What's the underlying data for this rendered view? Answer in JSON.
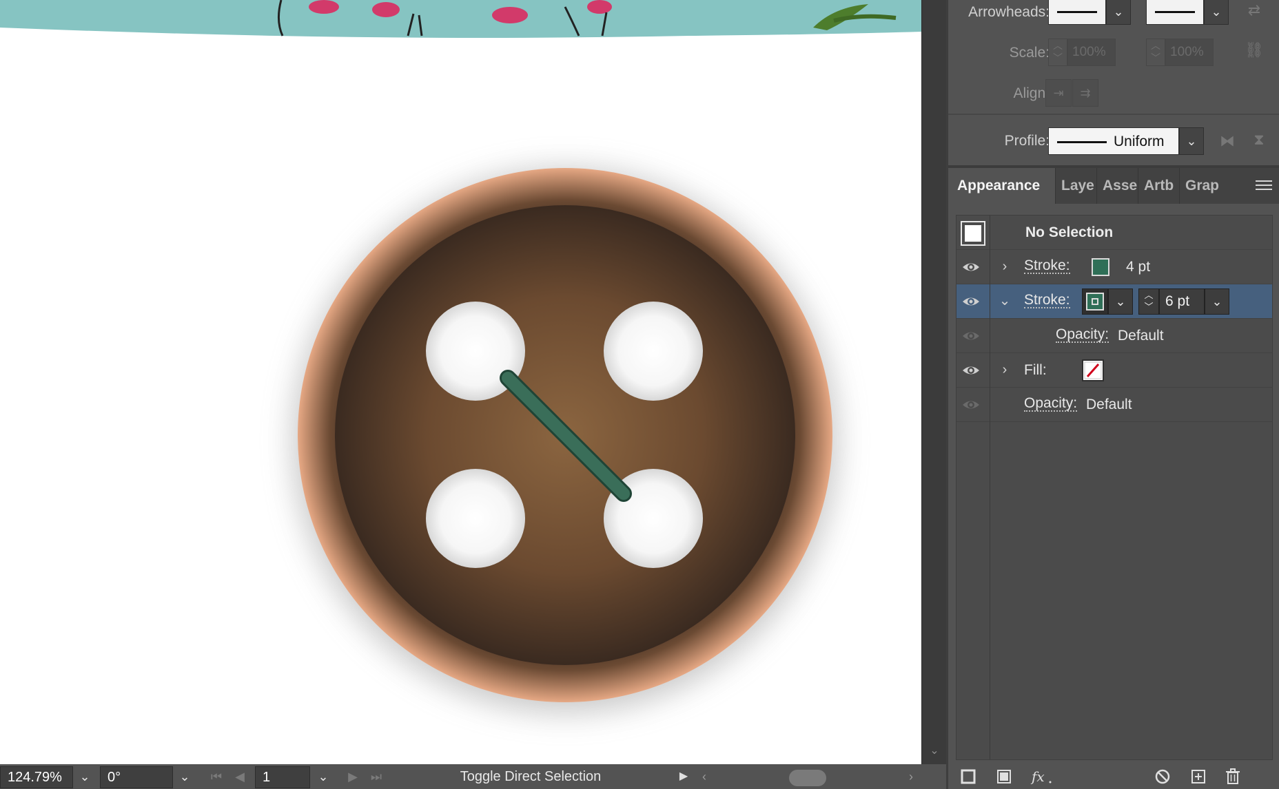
{
  "status_bar": {
    "zoom": "124.79%",
    "rotation": "0°",
    "artboard": "1",
    "status_text": "Toggle Direct Selection"
  },
  "stroke_panel": {
    "arrowheads_label": "Arrowheads:",
    "scale_label": "Scale:",
    "scale_start": "100%",
    "scale_end": "100%",
    "align_label": "Align:",
    "profile_label": "Profile:",
    "profile_value": "Uniform"
  },
  "tabs": [
    "Appearance",
    "Laye",
    "Asse",
    "Artb",
    "Grap"
  ],
  "appearance": {
    "selection_title": "No Selection",
    "stroke1": {
      "label": "Stroke:",
      "weight": "4 pt",
      "color": "#2f6f57"
    },
    "stroke2": {
      "label": "Stroke:",
      "weight": "6 pt",
      "color": "#2f6f57"
    },
    "stroke2_opacity": {
      "label": "Opacity:",
      "value": "Default"
    },
    "fill": {
      "label": "Fill:"
    },
    "opacity": {
      "label": "Opacity:",
      "value": "Default"
    }
  },
  "colors": {
    "panel_bg": "#535353",
    "selected_row": "#46607e",
    "button_brown": "#7d5a3a",
    "thread_green": "#3a6e59"
  },
  "icons": {
    "canvas_banner": "flamingo-pattern-strip",
    "list_bottom": [
      "new-stroke-icon",
      "new-fill-icon",
      "fx-icon",
      "clear-appearance-icon",
      "duplicate-item-icon",
      "delete-item-icon"
    ]
  }
}
